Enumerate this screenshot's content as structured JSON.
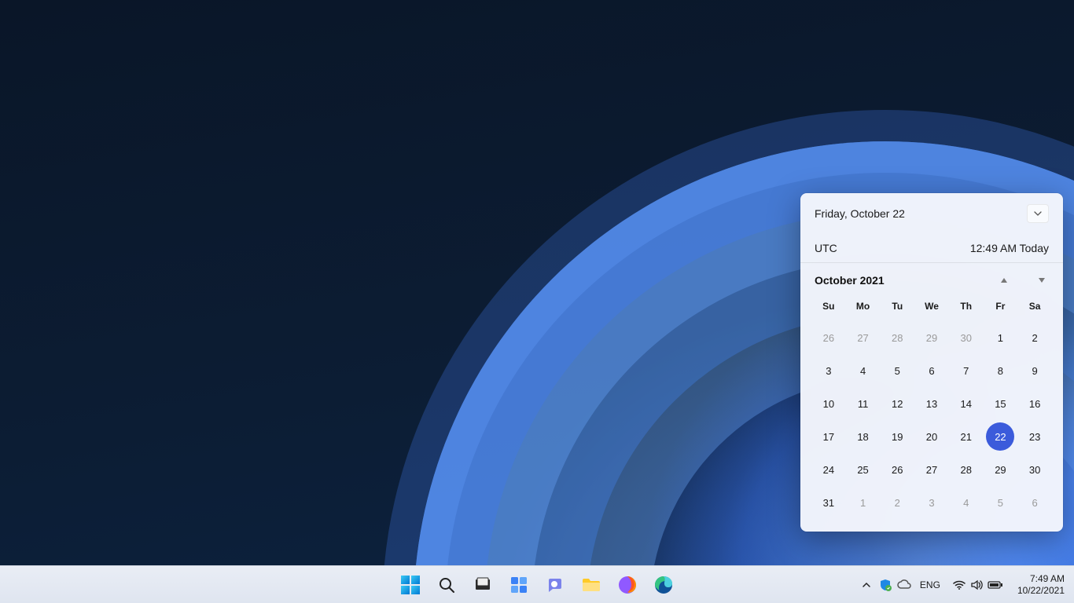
{
  "calendar": {
    "header_date": "Friday, October 22",
    "tz_label": "UTC",
    "tz_time": "12:49 AM Today",
    "month_title": "October 2021",
    "weekdays": [
      "Su",
      "Mo",
      "Tu",
      "We",
      "Th",
      "Fr",
      "Sa"
    ],
    "cells": [
      {
        "n": "26",
        "out": true
      },
      {
        "n": "27",
        "out": true
      },
      {
        "n": "28",
        "out": true
      },
      {
        "n": "29",
        "out": true
      },
      {
        "n": "30",
        "out": true
      },
      {
        "n": "1"
      },
      {
        "n": "2"
      },
      {
        "n": "3"
      },
      {
        "n": "4"
      },
      {
        "n": "5"
      },
      {
        "n": "6"
      },
      {
        "n": "7"
      },
      {
        "n": "8"
      },
      {
        "n": "9"
      },
      {
        "n": "10"
      },
      {
        "n": "11"
      },
      {
        "n": "12"
      },
      {
        "n": "13"
      },
      {
        "n": "14"
      },
      {
        "n": "15"
      },
      {
        "n": "16"
      },
      {
        "n": "17"
      },
      {
        "n": "18"
      },
      {
        "n": "19"
      },
      {
        "n": "20"
      },
      {
        "n": "21"
      },
      {
        "n": "22",
        "today": true
      },
      {
        "n": "23"
      },
      {
        "n": "24"
      },
      {
        "n": "25"
      },
      {
        "n": "26"
      },
      {
        "n": "27"
      },
      {
        "n": "28"
      },
      {
        "n": "29"
      },
      {
        "n": "30"
      },
      {
        "n": "31"
      },
      {
        "n": "1",
        "out": true
      },
      {
        "n": "2",
        "out": true
      },
      {
        "n": "3",
        "out": true
      },
      {
        "n": "4",
        "out": true
      },
      {
        "n": "5",
        "out": true
      },
      {
        "n": "6",
        "out": true
      }
    ]
  },
  "taskbar": {
    "lang": "ENG",
    "time": "7:49 AM",
    "date": "10/22/2021"
  }
}
